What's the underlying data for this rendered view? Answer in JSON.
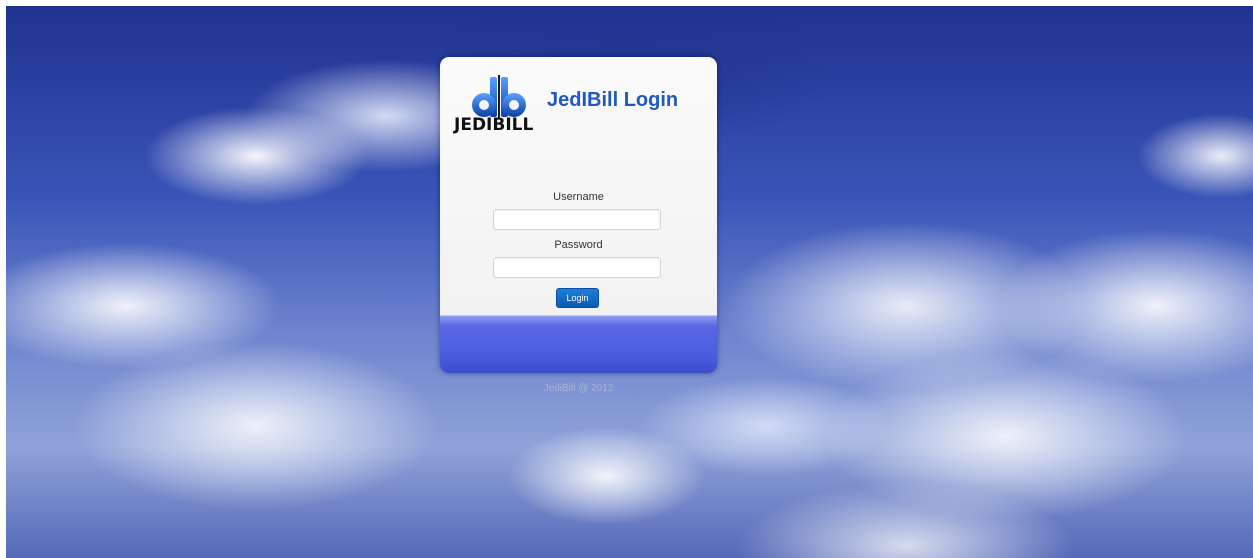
{
  "header": {
    "title": "JedIBill Login",
    "logo_text": "JEDIBILL",
    "logo_monogram": "db"
  },
  "form": {
    "username_label": "Username",
    "username_value": "",
    "password_label": "Password",
    "password_value": "",
    "submit_label": "Login"
  },
  "footer": {
    "copyright": "JediBill @ 2012"
  },
  "colors": {
    "title": "#2159c4",
    "button": "#0b5cb3",
    "card_band": "#4a5be0",
    "sky": "#3a55b8"
  },
  "icons": {
    "logo": "jedibill-logo-icon"
  }
}
